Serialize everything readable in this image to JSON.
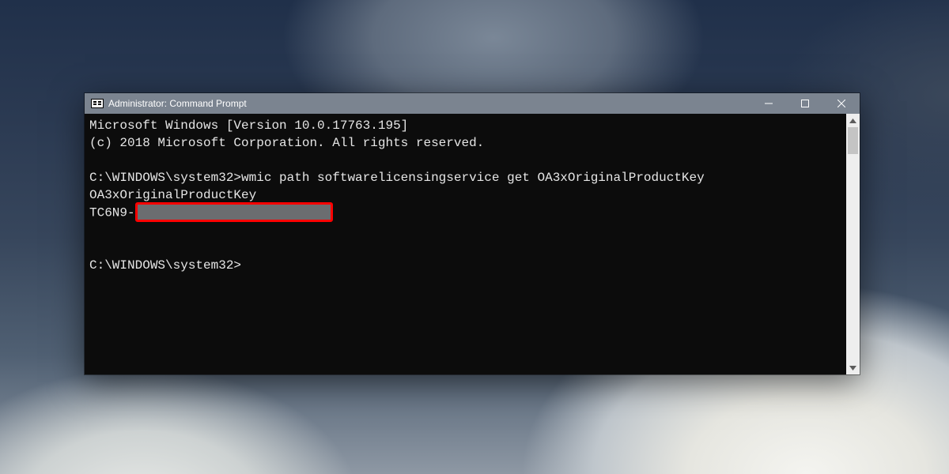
{
  "window": {
    "title": "Administrator: Command Prompt"
  },
  "console": {
    "banner_version": "Microsoft Windows [Version 10.0.17763.195]",
    "banner_copyright": "(c) 2018 Microsoft Corporation. All rights reserved.",
    "prompt1_prefix": "C:\\WINDOWS\\system32>",
    "prompt1_command": "wmic path softwarelicensingservice get OA3xOriginalProductKey",
    "output_header": "OA3xOriginalProductKey",
    "output_key_visible": "TC6N9-",
    "prompt2_prefix": "C:\\WINDOWS\\system32>"
  }
}
